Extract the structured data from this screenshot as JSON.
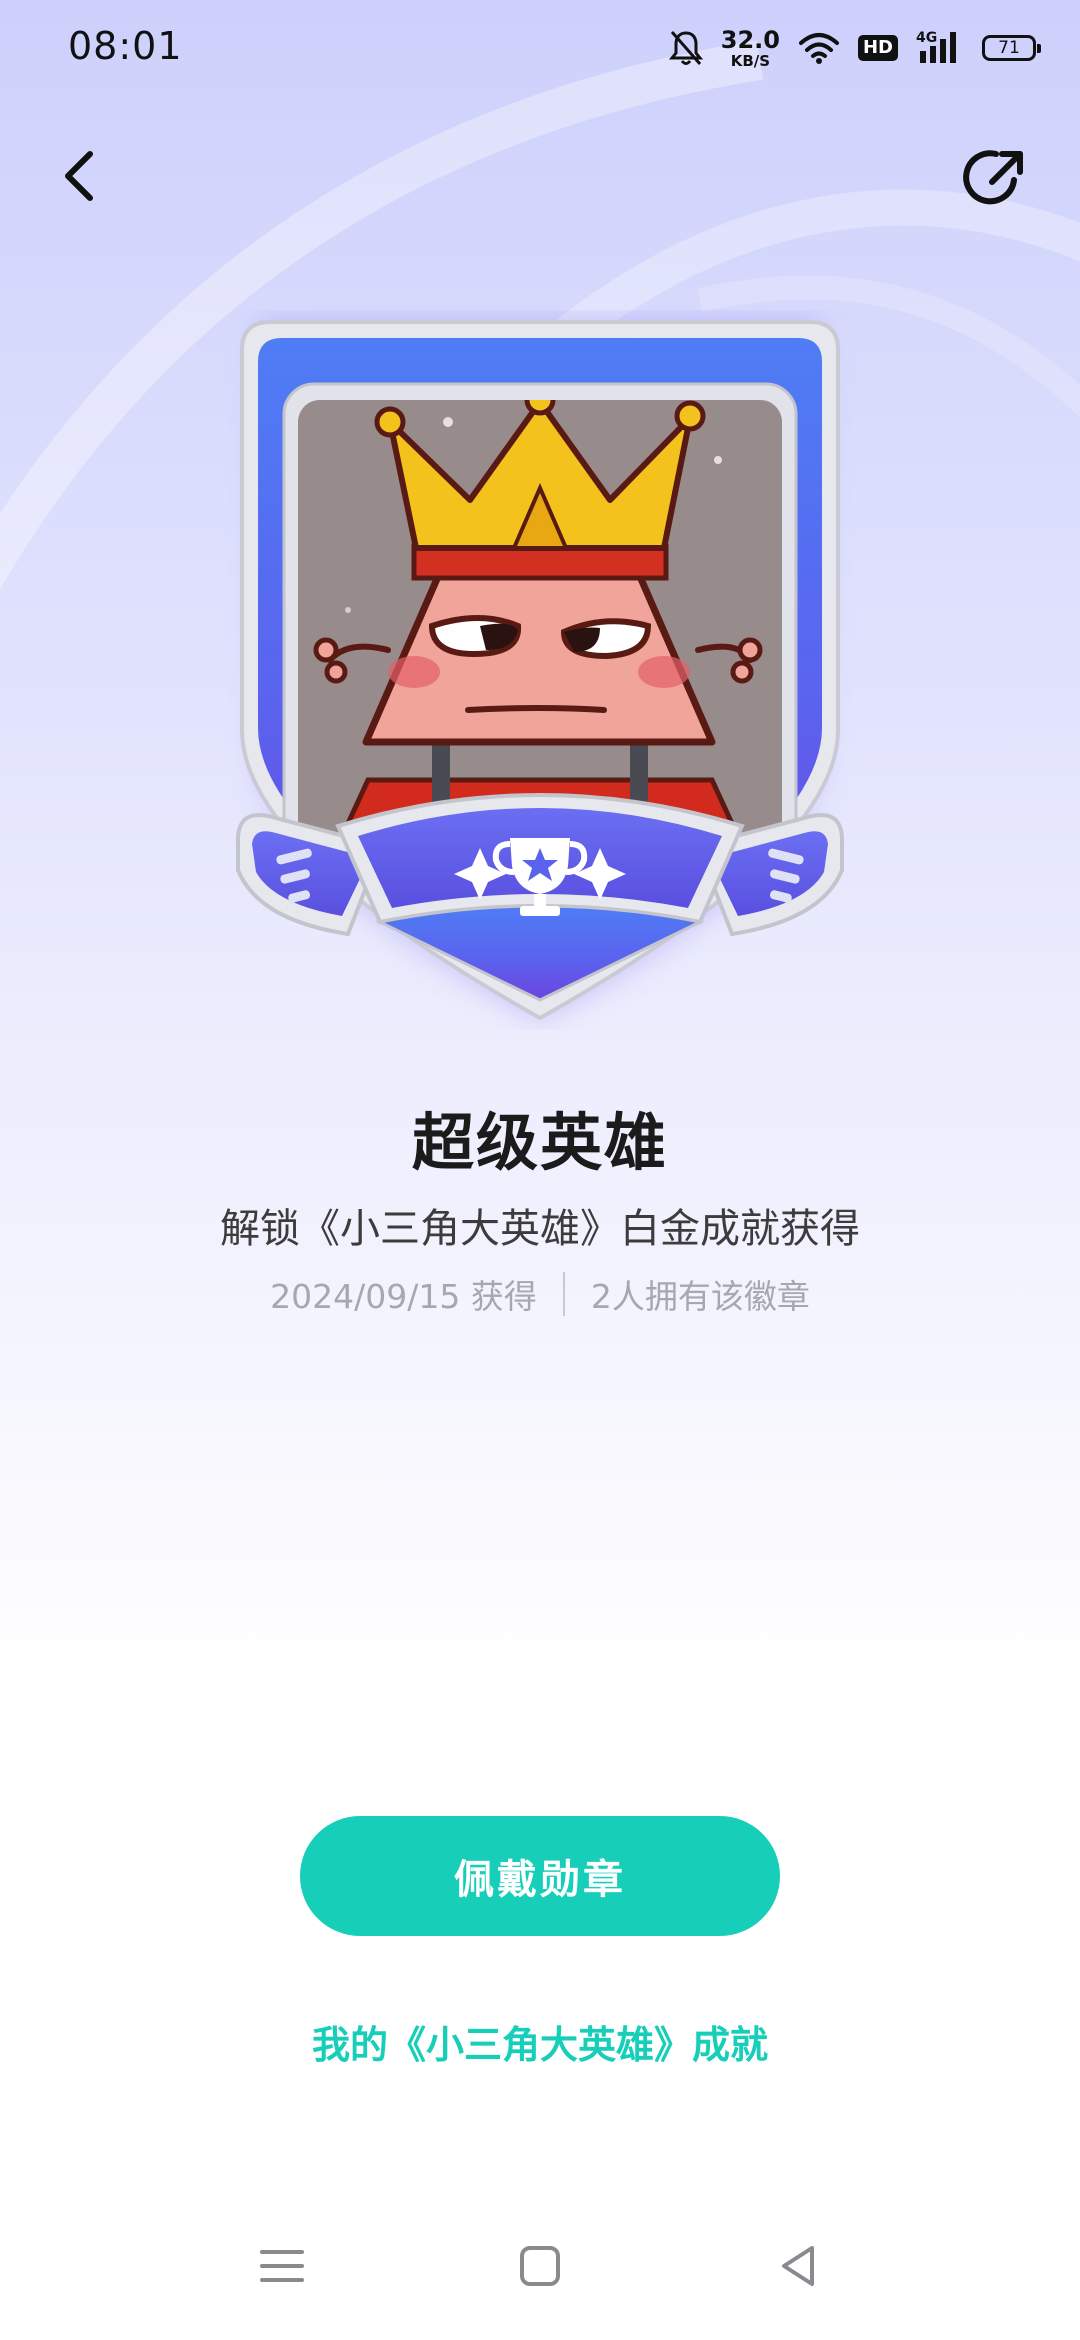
{
  "status_bar": {
    "time": "08:01",
    "net_speed_value": "32.0",
    "net_speed_unit": "KB/S",
    "hd_label": "HD",
    "network_label": "4G",
    "battery_level": "71",
    "icons": [
      "bell-muted-icon",
      "wifi-icon",
      "hd-icon",
      "signal-4g-icon",
      "battery-icon"
    ]
  },
  "header": {
    "back_icon": "chevron-left-icon",
    "share_icon": "share-icon"
  },
  "badge": {
    "image": "badge-crowned-triangle-hero-icon",
    "title": "超级英雄",
    "description": "解锁《小三角大英雄》白金成就获得",
    "earned_date": "2024/09/15 获得",
    "owners": "2人拥有该徽章"
  },
  "actions": {
    "wear_button_label": "佩戴勋章",
    "achievement_link": "我的《小三角大英雄》成就"
  },
  "colors": {
    "accent": "#17cfb8",
    "badge_blue": "#5b6cf2",
    "badge_purple": "#6a48e0",
    "crown_yellow": "#f3c21d",
    "character_pink": "#f0a49a"
  },
  "system_nav": {
    "icons": [
      "menu-icon",
      "home-square-icon",
      "back-triangle-icon"
    ]
  }
}
